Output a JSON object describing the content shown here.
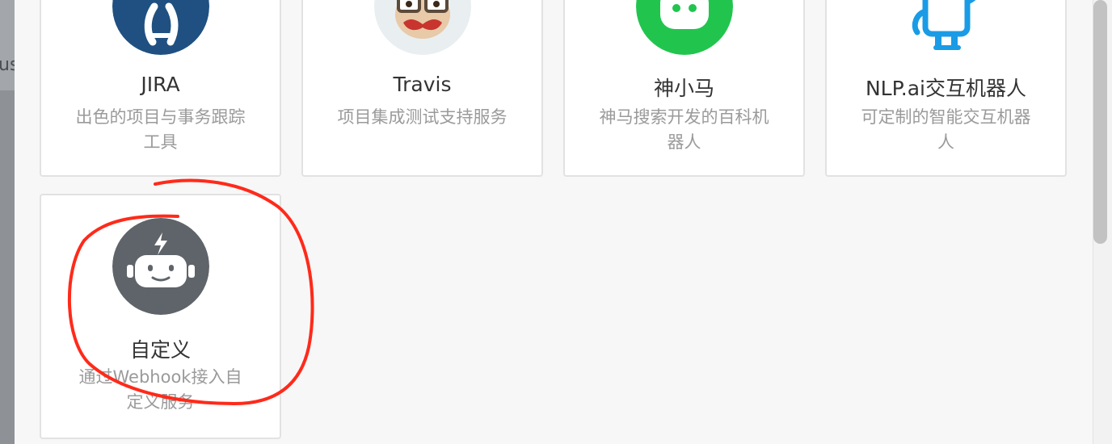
{
  "backdrop": {
    "fragment_text": "us"
  },
  "integrations": [
    {
      "name": "JIRA",
      "description": "出色的项目与事务跟踪工具",
      "icon": "jira-logo-icon",
      "color": "#205081"
    },
    {
      "name": "Travis",
      "description": "项目集成测试支持服务",
      "icon": "travis-mascot-icon",
      "color": "#e9eef0"
    },
    {
      "name": "神小马",
      "description": "神马搜索开发的百科机器人",
      "icon": "shenxiaoma-bot-icon",
      "color": "#21c54e"
    },
    {
      "name": "NLP.ai交互机器人",
      "description": "可定制的智能交互机器人",
      "icon": "nlp-robot-icon",
      "color": "#1a9be6"
    },
    {
      "name": "自定义",
      "description": "通过Webhook接入自定义服务",
      "icon": "custom-robot-icon",
      "color": "#5f646a"
    }
  ],
  "annotation": {
    "color": "#ff2a1a",
    "shape": "hand-drawn circle around custom integration card"
  }
}
